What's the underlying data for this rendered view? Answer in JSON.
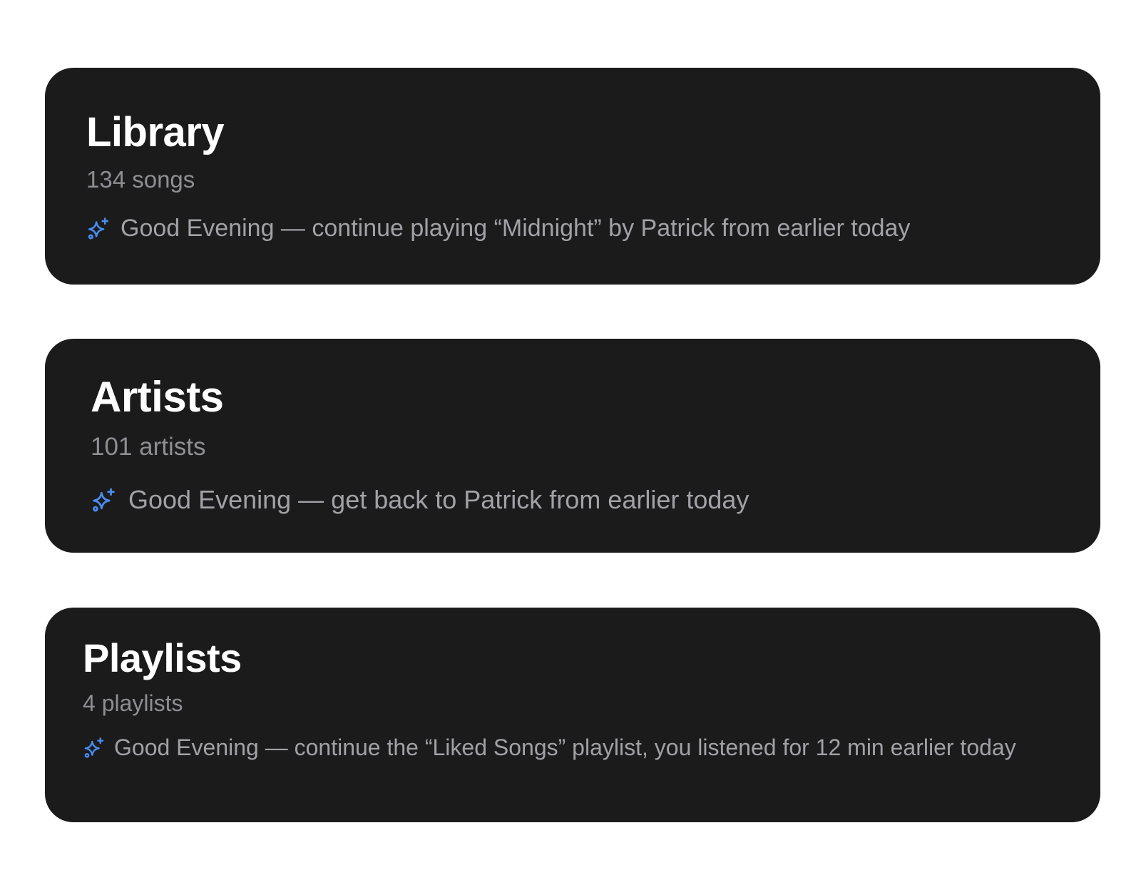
{
  "colors": {
    "card_background": "#1b1b1c",
    "title": "#ffffff",
    "count": "#8e8e93",
    "hint": "#a1a1a6",
    "accent": "#4a8cf0"
  },
  "cards": [
    {
      "title": "Library",
      "count": "134 songs",
      "icon": "sparkle-icon",
      "hint": "Good Evening — continue playing “Midnight” by Patrick from earlier today"
    },
    {
      "title": "Artists",
      "count": "101 artists",
      "icon": "sparkle-icon",
      "hint": "Good Evening — get back to Patrick from earlier today"
    },
    {
      "title": "Playlists",
      "count": "4 playlists",
      "icon": "sparkle-icon",
      "hint": "Good Evening — continue the “Liked Songs” playlist, you listened for 12 min earlier today"
    }
  ]
}
